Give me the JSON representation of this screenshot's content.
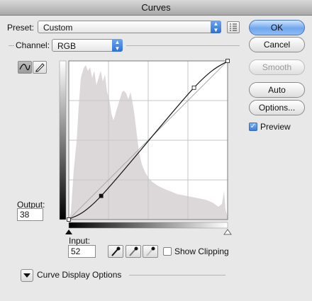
{
  "window": {
    "title": "Curves"
  },
  "preset": {
    "label": "Preset:",
    "value": "Custom"
  },
  "channel": {
    "label": "Channel:",
    "value": "RGB"
  },
  "buttons": {
    "ok": "OK",
    "cancel": "Cancel",
    "smooth": "Smooth",
    "auto": "Auto",
    "options": "Options..."
  },
  "preview": {
    "label": "Preview",
    "checked": true
  },
  "output": {
    "label": "Output:",
    "value": "38"
  },
  "input": {
    "label": "Input:",
    "value": "52"
  },
  "show_clipping": {
    "label": "Show Clipping",
    "checked": false
  },
  "curve_display_options": {
    "label": "Curve Display Options"
  },
  "curve": {
    "range": [
      0,
      255
    ],
    "points": [
      [
        0,
        0
      ],
      [
        52,
        38
      ],
      [
        201,
        212
      ],
      [
        255,
        255
      ]
    ]
  }
}
